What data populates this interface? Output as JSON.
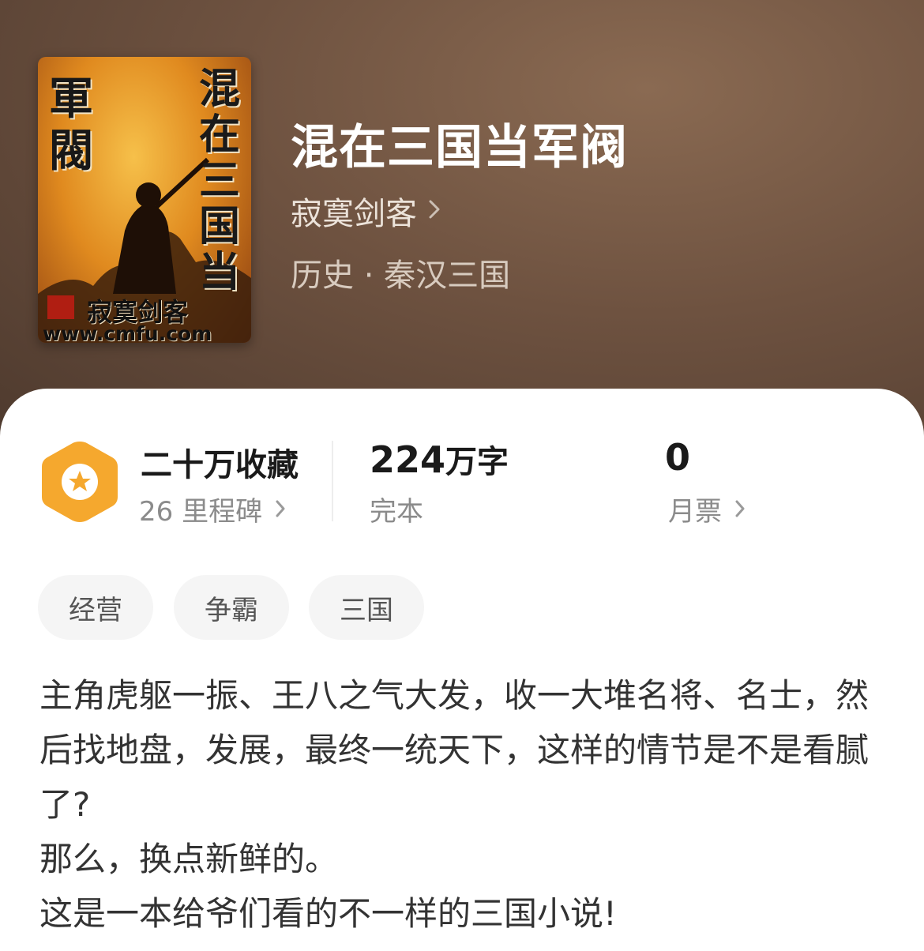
{
  "book": {
    "title": "混在三国当军阀",
    "author": "寂寞剑客",
    "category": "历史 · 秦汉三国"
  },
  "cover": {
    "vertical_title": "混在三国当",
    "series_text": "軍閥",
    "author_text": "寂寞剑客",
    "url_text": "www.cmfu.com"
  },
  "stats": {
    "collections": {
      "value": "二十万收藏",
      "sub": "26 里程碑"
    },
    "words": {
      "number": "224",
      "unit": "万字",
      "sub": "完本"
    },
    "votes": {
      "value": "0",
      "sub": "月票"
    }
  },
  "tags": [
    "经营",
    "争霸",
    "三国"
  ],
  "description": [
    "主角虎躯一振、王八之气大发，收一大堆名将、名士，然后找地盘，发展，最终一统天下，这样的情节是不是看腻了?",
    "那么，换点新鲜的。",
    "这是一本给爷们看的不一样的三国小说!"
  ],
  "colors": {
    "hero_bg": "#6e5240",
    "badge": "#f5a82e",
    "sheet": "#ffffff"
  },
  "icons": [
    "chevron-right-icon",
    "star-icon",
    "hexagon-badge-icon"
  ]
}
